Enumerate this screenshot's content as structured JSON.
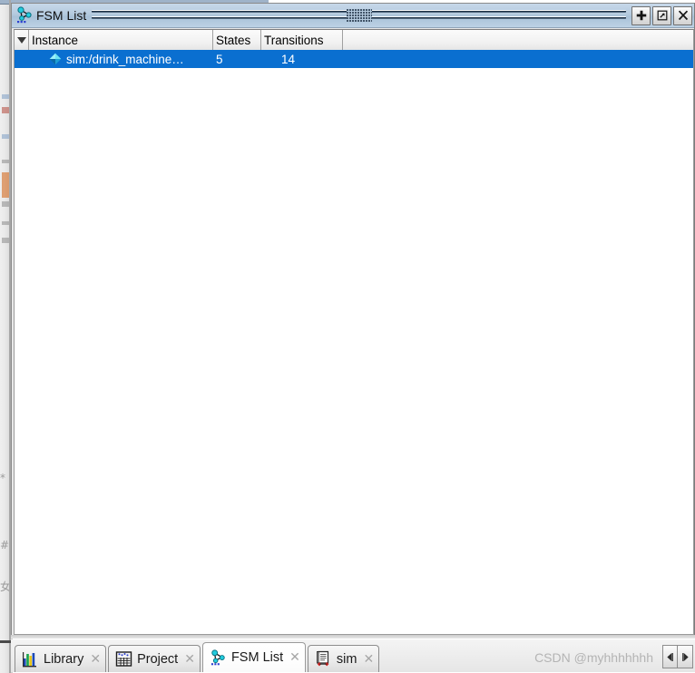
{
  "window": {
    "title": "FSM List",
    "title_icon": "fsm-graph-icon",
    "buttons": [
      {
        "name": "add-button",
        "glyph": "+",
        "label": "Add"
      },
      {
        "name": "undock-button",
        "glyph": "⇗",
        "label": "Undock"
      },
      {
        "name": "close-button",
        "glyph": "✕",
        "label": "Close"
      }
    ]
  },
  "table": {
    "sort_indicator": "▼",
    "columns": [
      {
        "key": "instance",
        "label": "Instance"
      },
      {
        "key": "states",
        "label": "States"
      },
      {
        "key": "transitions",
        "label": "Transitions"
      },
      {
        "key": "filler",
        "label": ""
      }
    ],
    "rows": [
      {
        "icon": "diamond-icon",
        "instance": "sim:/drink_machine…",
        "states": "5",
        "transitions": "14",
        "selected": true
      }
    ]
  },
  "tabs": [
    {
      "name": "tab-library",
      "label": "Library",
      "icon": "bar-chart-icon",
      "active": false,
      "close": "✕"
    },
    {
      "name": "tab-project",
      "label": "Project",
      "icon": "project-grid-icon",
      "active": false,
      "close": "✕"
    },
    {
      "name": "tab-fsm-list",
      "label": "FSM List",
      "icon": "fsm-graph-icon",
      "active": true,
      "close": "✕"
    },
    {
      "name": "tab-sim",
      "label": "sim",
      "icon": "sim-doc-icon",
      "active": false,
      "close": "✕"
    }
  ],
  "tab_scroll": {
    "left_glyph": "◀",
    "right_glyph": "▶"
  },
  "watermark": {
    "text": "CSDN @myhhhhhhh"
  },
  "colors": {
    "selection_blue": "#0a6fd0",
    "titlebar_blue": "#b4cade",
    "icon_cyan": "#23c8dd",
    "accent_red": "#cc2222"
  }
}
